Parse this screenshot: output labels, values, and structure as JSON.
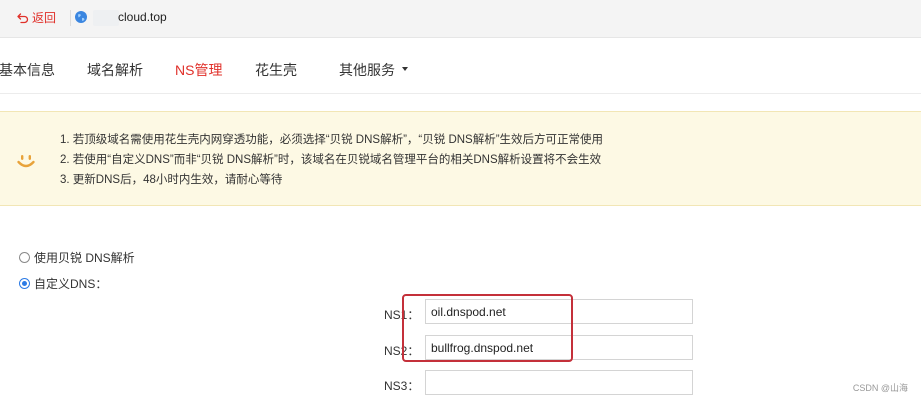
{
  "topbar": {
    "back_label": "返回",
    "domain": "cloud.top"
  },
  "tabs": [
    {
      "label": "基本信息",
      "active": false
    },
    {
      "label": "域名解析",
      "active": false
    },
    {
      "label": "NS管理",
      "active": true
    },
    {
      "label": "花生壳",
      "active": false
    },
    {
      "label": "其他服务",
      "active": false
    }
  ],
  "notice": {
    "items": [
      "1. 若顶级域名需使用花生壳内网穿透功能，必须选择“贝锐 DNS解析”，“贝锐 DNS解析”生效后方可正常使用",
      "2. 若使用“自定义DNS”而非“贝锐 DNS解析”时，该域名在贝锐域名管理平台的相关DNS解析设置将不会生效",
      "3. 更新DNS后，48小时内生效，请耐心等待"
    ]
  },
  "options": {
    "beirui_dns": {
      "label": "使用贝锐 DNS解析",
      "checked": false
    },
    "custom_dns": {
      "label": "自定义DNS：",
      "checked": true
    }
  },
  "ns": [
    {
      "label": "NS1：",
      "value": "oil.dnspod.net"
    },
    {
      "label": "NS2：",
      "value": "bullfrog.dnspod.net"
    },
    {
      "label": "NS3：",
      "value": ""
    }
  ],
  "watermark": "CSDN @山海",
  "colors": {
    "accent": "#e0302a",
    "notice_bg": "#fdf9e4",
    "smile": "#e8a33a",
    "radio_checked": "#2c7be5",
    "highlight": "#c4303a"
  }
}
